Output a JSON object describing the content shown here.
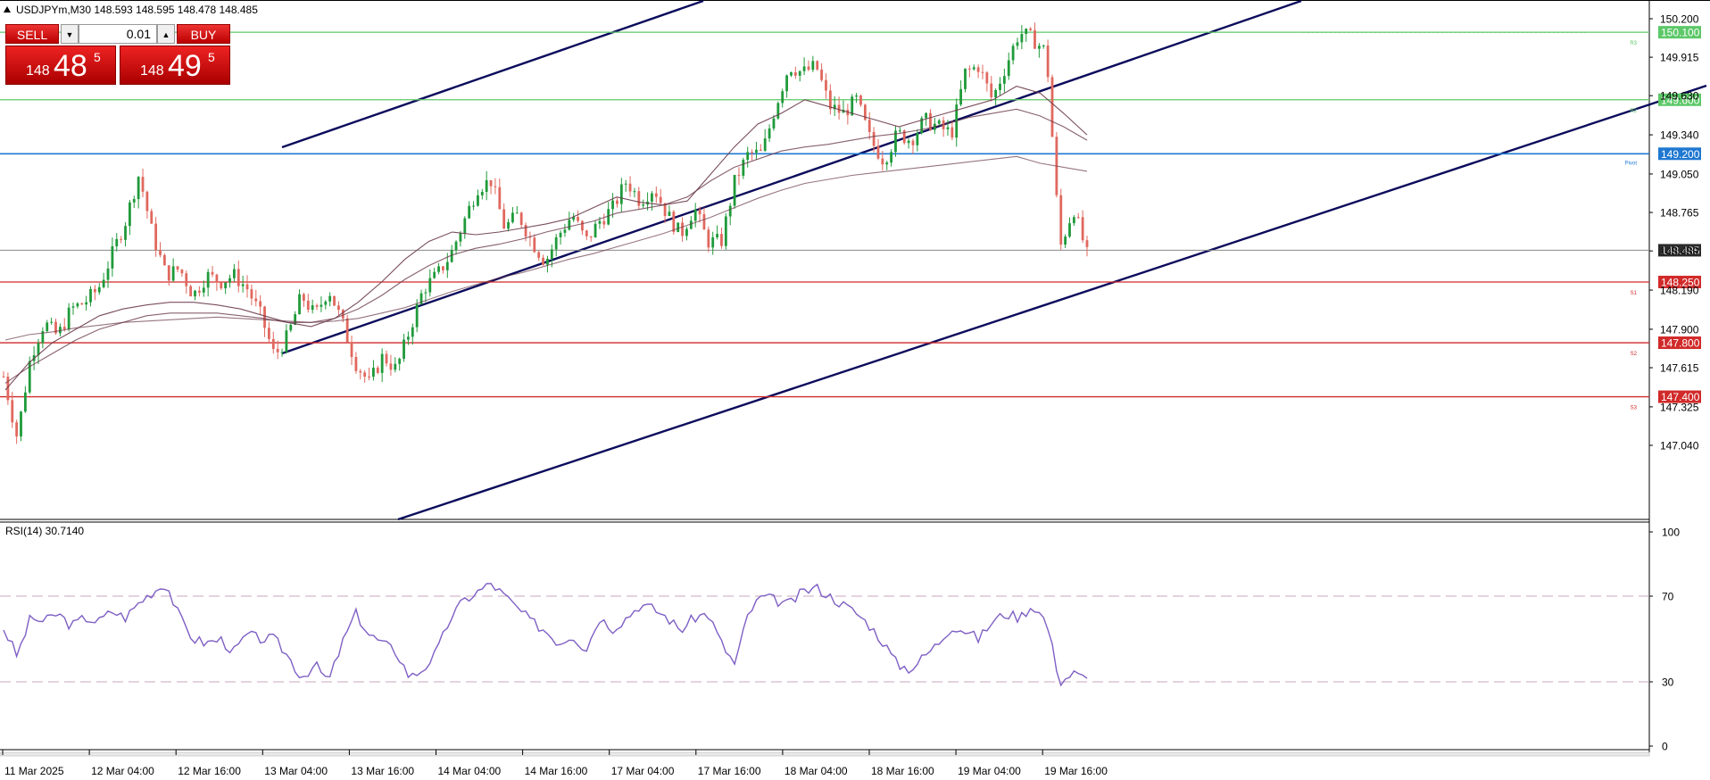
{
  "header": {
    "symbol_info": "USDJPYm,M30  148.593 148.595 148.478 148.485"
  },
  "trade_panel": {
    "sell_label": "SELL",
    "buy_label": "BUY",
    "lot": "0.01",
    "bid_small": "148",
    "bid_big": "48",
    "bid_sup": "5",
    "ask_small": "148",
    "ask_big": "49",
    "ask_sup": "5"
  },
  "colors": {
    "up": "#1f9a3a",
    "down": "#e0685e",
    "resistance": "#5cc868",
    "support": "#d12a2a",
    "pivot": "#1f78d1",
    "channel": "#0b0b5c",
    "rsi": "#7e5fc4",
    "ma": "#6a3a4a"
  },
  "chart_data": [
    {
      "type": "candlestick",
      "symbol": "USDJPYm",
      "timeframe": "M30",
      "ylim": [
        146.95,
        150.27
      ],
      "y_ticks": [
        "150.200",
        "149.915",
        "149.630",
        "149.340",
        "149.050",
        "148.765",
        "148.480",
        "148.190",
        "147.900",
        "147.615",
        "147.325",
        "147.040"
      ],
      "x_ticks": [
        "11 Mar 2025",
        "12 Mar 04:00",
        "12 Mar 16:00",
        "13 Mar 04:00",
        "13 Mar 16:00",
        "14 Mar 04:00",
        "14 Mar 16:00",
        "17 Mar 04:00",
        "17 Mar 16:00",
        "18 Mar 04:00",
        "18 Mar 16:00",
        "19 Mar 04:00",
        "19 Mar 16:00"
      ],
      "current_price": "148.485",
      "levels": [
        {
          "name": "R3",
          "label": "150.100",
          "value": 150.1,
          "kind": "resistance"
        },
        {
          "name": "R2",
          "label": "149.600",
          "value": 149.6,
          "kind": "resistance"
        },
        {
          "name": "Pivot",
          "label": "149.200",
          "value": 149.2,
          "kind": "pivot"
        },
        {
          "name": "S1",
          "label": "148.250",
          "value": 148.25,
          "kind": "support"
        },
        {
          "name": "S2",
          "label": "147.800",
          "value": 147.8,
          "kind": "support"
        },
        {
          "name": "S3",
          "label": "147.400",
          "value": 147.4,
          "kind": "support"
        }
      ],
      "close_path": [
        147.55,
        147.1,
        147.7,
        147.95,
        147.85,
        148.05,
        148.1,
        148.2,
        148.45,
        148.7,
        149.05,
        148.6,
        148.3,
        148.35,
        148.15,
        148.3,
        148.25,
        148.3,
        148.2,
        148.0,
        147.7,
        147.85,
        148.15,
        148.0,
        148.2,
        147.95,
        147.65,
        147.5,
        147.7,
        147.6,
        147.9,
        148.2,
        148.3,
        148.45,
        148.7,
        148.95,
        149.0,
        148.65,
        148.75,
        148.55,
        148.4,
        148.6,
        148.75,
        148.55,
        148.7,
        148.8,
        149.0,
        148.85,
        148.95,
        148.75,
        148.6,
        148.8,
        148.55,
        148.55,
        149.0,
        149.2,
        149.2,
        149.55,
        149.85,
        149.8,
        149.85,
        149.55,
        149.5,
        149.6,
        149.3,
        149.15,
        149.35,
        149.3,
        149.45,
        149.4,
        149.35,
        149.8,
        149.85,
        149.6,
        149.85,
        150.1,
        150.05,
        149.95,
        148.5,
        148.8,
        148.45
      ],
      "ma_fast": [
        147.45,
        147.65,
        147.8,
        147.9,
        148.0,
        148.05,
        148.08,
        148.1,
        148.1,
        148.08,
        148.05,
        148.0,
        147.95,
        147.92,
        147.98,
        148.1,
        148.25,
        148.42,
        148.55,
        148.62,
        148.6,
        148.62,
        148.65,
        148.68,
        148.72,
        148.8,
        148.88,
        148.84,
        148.82,
        148.85,
        149.05,
        149.25,
        149.42,
        149.5,
        149.6,
        149.55,
        149.5,
        149.45,
        149.4,
        149.45,
        149.5,
        149.55,
        149.6,
        149.7,
        149.65,
        149.5,
        149.34
      ],
      "ma_slow": [
        147.5,
        147.62,
        147.72,
        147.82,
        147.9,
        147.95,
        148.0,
        148.02,
        148.02,
        148.02,
        148.0,
        147.98,
        147.95,
        147.95,
        147.98,
        148.05,
        148.15,
        148.27,
        148.37,
        148.45,
        148.5,
        148.53,
        148.57,
        148.62,
        148.66,
        148.7,
        148.76,
        148.79,
        148.82,
        148.88,
        149.0,
        149.1,
        149.16,
        149.22,
        149.25,
        149.27,
        149.3,
        149.33,
        149.35,
        149.38,
        149.42,
        149.47,
        149.5,
        149.53,
        149.48,
        149.4,
        149.3
      ],
      "ma_long": [
        147.82,
        147.86,
        147.88,
        147.91,
        147.93,
        147.95,
        147.96,
        147.97,
        147.98,
        147.99,
        147.98,
        147.97,
        147.96,
        147.95,
        147.96,
        147.98,
        148.02,
        148.06,
        148.12,
        148.18,
        148.23,
        148.28,
        148.32,
        148.37,
        148.42,
        148.46,
        148.51,
        148.56,
        148.61,
        148.67,
        148.73,
        148.8,
        148.87,
        148.93,
        148.98,
        149.01,
        149.04,
        149.06,
        149.08,
        149.1,
        149.12,
        149.14,
        149.16,
        149.18,
        149.13,
        149.1,
        149.07
      ]
    },
    {
      "type": "line",
      "name": "RSI",
      "indicator_label": "RSI(14) 30.7140",
      "ylim": [
        0,
        100
      ],
      "y_ticks": [
        "100",
        "70",
        "30",
        "0"
      ],
      "levels": [
        70,
        30
      ],
      "rsi_path": [
        55,
        42,
        60,
        58,
        62,
        56,
        60,
        58,
        63,
        60,
        67,
        72,
        76,
        60,
        50,
        48,
        50,
        44,
        52,
        50,
        50,
        42,
        32,
        38,
        30,
        48,
        62,
        52,
        48,
        44,
        32,
        36,
        44,
        60,
        68,
        72,
        76,
        70,
        64,
        58,
        54,
        48,
        52,
        45,
        60,
        55,
        60,
        66,
        64,
        60,
        54,
        60,
        62,
        48,
        38,
        62,
        70,
        68,
        66,
        72,
        74,
        70,
        66,
        62,
        56,
        48,
        38,
        36,
        42,
        48,
        56,
        54,
        50,
        58,
        62,
        60,
        66,
        58,
        30,
        34,
        31
      ]
    }
  ]
}
